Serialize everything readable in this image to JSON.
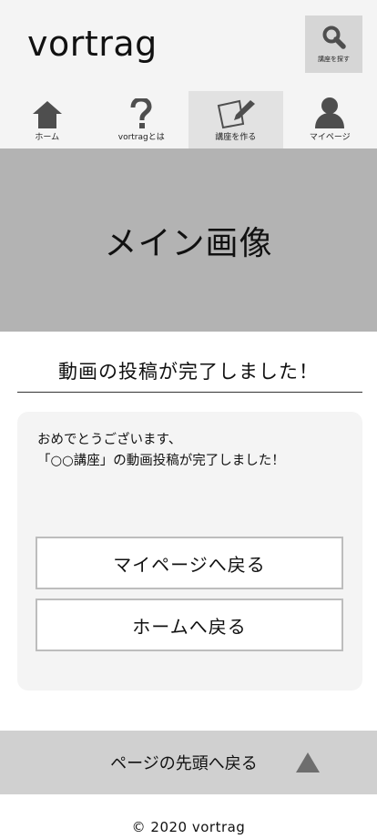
{
  "header": {
    "logo": "vortrag",
    "search_label": "講座を探す"
  },
  "nav": {
    "items": [
      {
        "label": "ホーム",
        "icon": "home-icon"
      },
      {
        "label": "vortragとは",
        "icon": "question-icon"
      },
      {
        "label": "講座を作る",
        "icon": "edit-icon"
      },
      {
        "label": "マイページ",
        "icon": "user-icon"
      }
    ]
  },
  "hero": {
    "text": "メイン画像"
  },
  "main": {
    "title": "動画の投稿が完了しました！",
    "message_line1": "おめでとうございます、",
    "message_line2": "「○○講座」の動画投稿が完了しました！",
    "buttons": {
      "mypage": "マイページへ戻る",
      "home": "ホームへ戻る"
    }
  },
  "to_top": {
    "label": "ページの先頭へ戻る",
    "icon": "triangle-up-icon"
  },
  "footer": {
    "copyright": "© 2020 vortrag"
  },
  "colors": {
    "header_bg": "#f4f4f4",
    "hero_bg": "#b3b3b3",
    "icon": "#555555",
    "to_top_bg": "#d0d0d0"
  }
}
